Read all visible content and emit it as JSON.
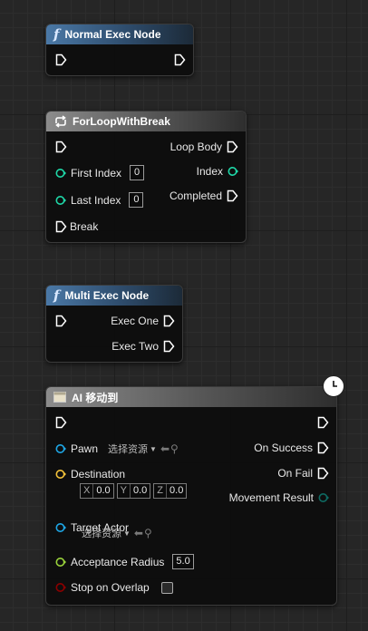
{
  "nodes": {
    "normal_exec": {
      "title": "Normal Exec Node",
      "icon": "function-icon"
    },
    "for_loop": {
      "title": "ForLoopWithBreak",
      "icon": "loop-icon",
      "first_index_label": "First Index",
      "first_index_value": "0",
      "last_index_label": "Last Index",
      "last_index_value": "0",
      "break_label": "Break",
      "loop_body_label": "Loop Body",
      "index_label": "Index",
      "completed_label": "Completed"
    },
    "multi_exec": {
      "title": "Multi Exec Node",
      "icon": "function-icon",
      "exec_one_label": "Exec One",
      "exec_two_label": "Exec Two"
    },
    "ai_move_to": {
      "title": "AI 移动到",
      "icon": "macro-node-icon",
      "pawn_label": "Pawn",
      "pawn_asset": "选择资源",
      "destination_label": "Destination",
      "destination": {
        "x_label": "X",
        "x": "0.0",
        "y_label": "Y",
        "y": "0.0",
        "z_label": "Z",
        "z": "0.0"
      },
      "target_actor_label": "Target Actor",
      "target_actor_asset": "选择资源",
      "acceptance_radius_label": "Acceptance Radius",
      "acceptance_radius_value": "5.0",
      "stop_on_overlap_label": "Stop on Overlap",
      "stop_on_overlap_checked": false,
      "on_success_label": "On Success",
      "on_fail_label": "On Fail",
      "movement_result_label": "Movement Result",
      "latent_icon": "clock-icon"
    }
  },
  "colors": {
    "exec_pin": "#ffffff",
    "object_pin": "#1ea7e6",
    "int_pin": "#1fd8a8",
    "vector_pin": "#f4c23a",
    "float_pin": "#9ad33b",
    "bool_pin": "#8c0000",
    "enum_pin": "#0e6a62",
    "function_header": "#4a78a6",
    "macro_header": "#8c8c8c"
  }
}
